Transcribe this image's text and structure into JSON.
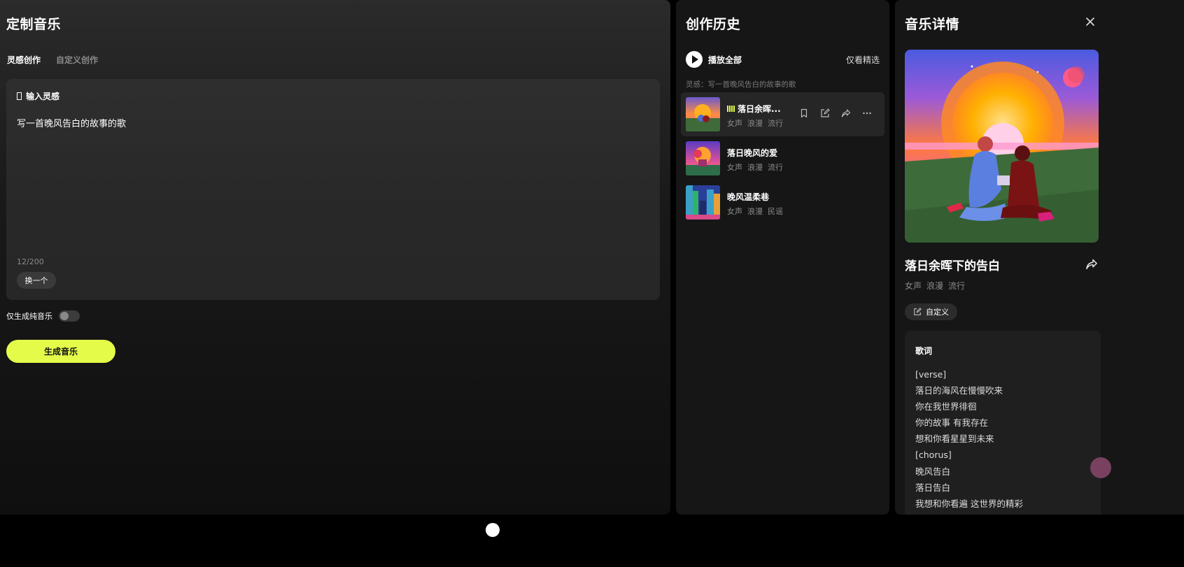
{
  "left": {
    "title": "定制音乐",
    "tabs": [
      {
        "label": "灵感创作",
        "active": true
      },
      {
        "label": "自定义创作",
        "active": false
      }
    ],
    "input_label": "输入灵感",
    "prompt": "写一首晚风告白的故事的歌",
    "char_count": "12/200",
    "swap_label": "换一个",
    "pure_music_label": "仅生成纯音乐",
    "pure_music_on": false,
    "generate_label": "生成音乐"
  },
  "history": {
    "title": "创作历史",
    "play_all": "播放全部",
    "featured_only": "仅看精选",
    "inspiration_note": "灵感：写一首晚风告白的故事的歌",
    "tracks": [
      {
        "name": "落日余晖...",
        "tags": [
          "女声",
          "浪漫",
          "流行"
        ],
        "playing": true
      },
      {
        "name": "落日晚风的爱",
        "tags": [
          "女声",
          "浪漫",
          "流行"
        ],
        "playing": false
      },
      {
        "name": "晚风温柔巷",
        "tags": [
          "女声",
          "浪漫",
          "民谣"
        ],
        "playing": false
      }
    ]
  },
  "detail": {
    "title": "音乐详情",
    "song_title": "落日余晖下的告白",
    "tags": [
      "女声",
      "浪漫",
      "流行"
    ],
    "custom_label": "自定义",
    "lyrics_title": "歌词",
    "lyrics": [
      "[verse]",
      "落日的海风在慢慢吹来",
      "你在我世界徘徊",
      "你的故事 有我存在",
      "想和你看星星到未来",
      "[chorus]",
      "晚风告白",
      "落日告白",
      "我想和你看遍 这世界的精彩"
    ]
  },
  "colors": {
    "accent": "#e4fb4a",
    "panel_bg": "#161616",
    "muted_text": "#8a8a8a"
  }
}
